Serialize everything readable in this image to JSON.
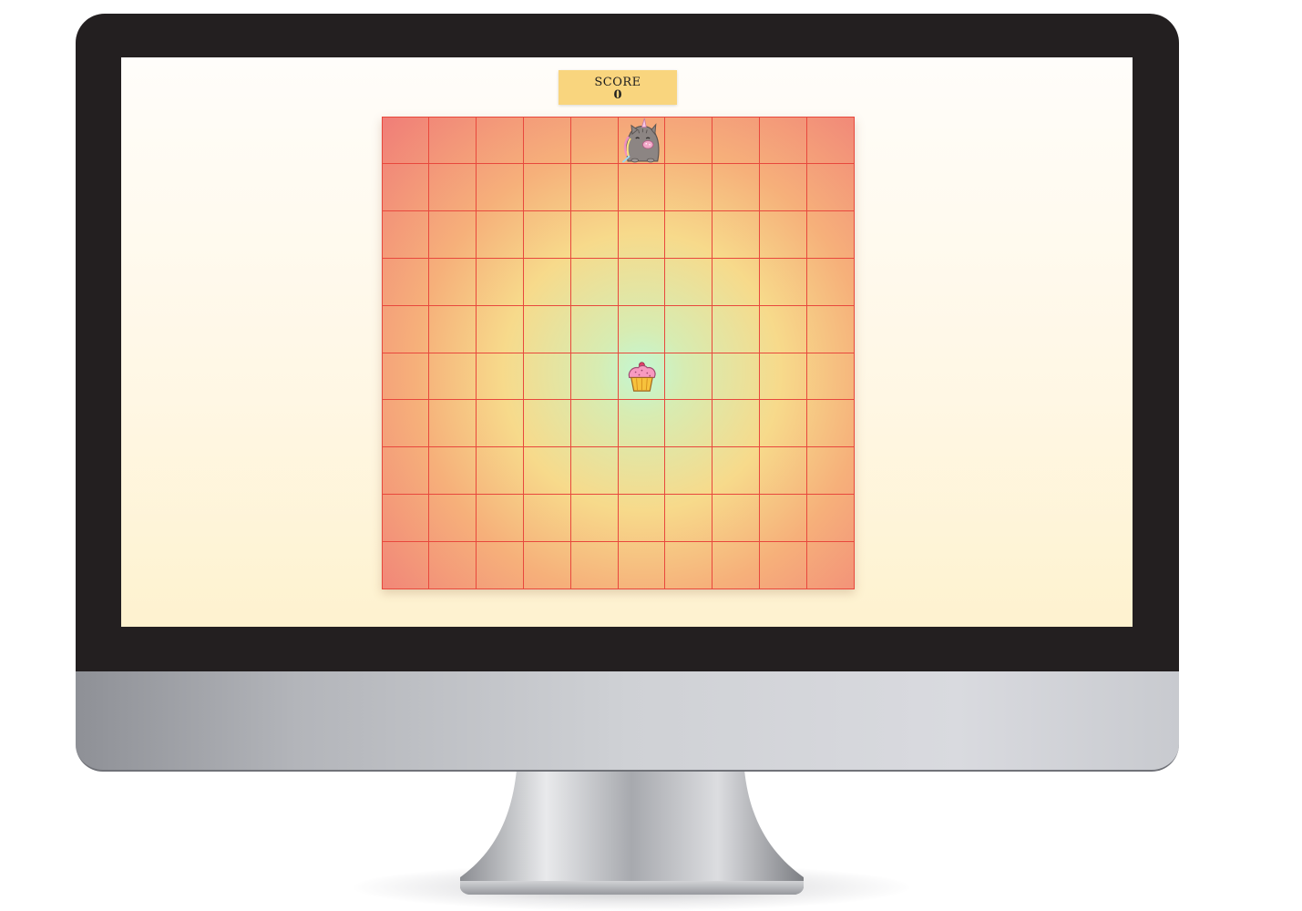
{
  "score": {
    "label": "SCORE",
    "value": "0"
  },
  "board": {
    "rows": 10,
    "cols": 10,
    "player": {
      "icon": "pusheen-unicorn-cat-icon",
      "row": 0,
      "col": 5
    },
    "food": {
      "icon": "cupcake-icon",
      "row": 5,
      "col": 5
    }
  },
  "colors": {
    "score_bg": "#f9d57e",
    "grid_line": "#e8483d",
    "board_center": "#c2f7d4",
    "board_edge": "#f07d78"
  }
}
